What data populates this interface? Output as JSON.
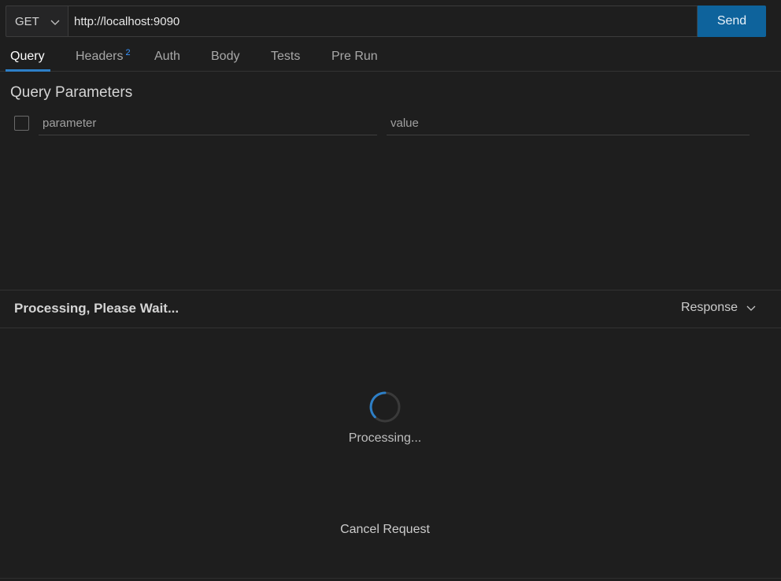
{
  "request": {
    "method": "GET",
    "url": "http://localhost:9090",
    "send_label": "Send"
  },
  "tabs": [
    {
      "label": "Query",
      "active": true
    },
    {
      "label": "Headers",
      "badge": "2"
    },
    {
      "label": "Auth"
    },
    {
      "label": "Body"
    },
    {
      "label": "Tests"
    },
    {
      "label": "Pre Run"
    }
  ],
  "query": {
    "title": "Query Parameters",
    "param_placeholder": "parameter",
    "value_placeholder": "value"
  },
  "response": {
    "status": "Processing, Please Wait...",
    "view_label": "Response",
    "processing_text": "Processing...",
    "cancel_label": "Cancel Request"
  },
  "colors": {
    "accent": "#0e639c",
    "tab_underline": "#2d7fc7",
    "badge": "#3794ff",
    "background": "#1e1e1e"
  }
}
